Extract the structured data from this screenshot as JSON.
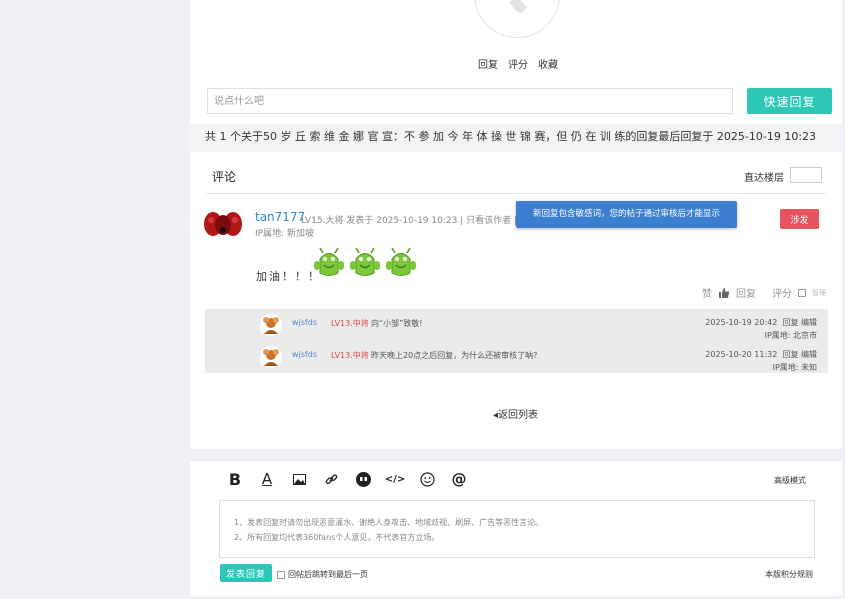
{
  "post_actions_top": [
    "回复",
    "评分",
    "收藏"
  ],
  "reply": {
    "placeholder": "说点什么吧",
    "quick_button": "快速回复"
  },
  "summary": "共 1 个关于50 岁 丘 索 维 金 娜 官 宣：不 参 加 今 年 体 操 世 锦 赛，但 仍 在 训 练的回复最后回复于 2025-10-19 10:23",
  "comments_section": {
    "title": "评论",
    "floor_jump_label": "直达楼层"
  },
  "post": {
    "username": "tan7177",
    "meta": "LV15.大将   发表于 2025-10-19 10:23   |  只看该作者   |",
    "ip": "IP属地: 新加坡",
    "text": "加油！！！",
    "notice": "新回复包含敏感词，您的帖子通过审核后才能显示",
    "report_button": "涉发",
    "actions": {
      "like": "赞",
      "reply": "回复",
      "rate": "评分",
      "manage": "管理"
    }
  },
  "subreplies": [
    {
      "name": "wjsfds",
      "rank": "LV13.中将",
      "text": "向“小邹”致敬!",
      "time": "2025-10-19 20:42",
      "reply": "回复",
      "edit": "编辑",
      "ip": "IP属地: 北京市"
    },
    {
      "name": "wjsfds",
      "rank": "LV13.中将",
      "text": "昨天晚上20点之后回复，为什么还被审核了呐?",
      "time": "2025-10-20 11:32",
      "reply": "回复",
      "edit": "编辑",
      "ip": "IP属地: 未知"
    }
  ],
  "back_link": "返回列表",
  "editor": {
    "advanced_mode": "高级模式",
    "notes": [
      "1、发表回复时请勿出现恶意灌水、谢绝人身攻击、地域歧视、刷屏、广告等恶性言论。",
      "2、所有回复均代表360fans个人意见，不代表官方立场。"
    ],
    "post_button": "发表回复",
    "jump_checkbox": "回帖后跳转到最后一页",
    "rules_link": "本版积分规则"
  },
  "colors": {
    "accent": "#2ec6b6",
    "link": "#2a88d8",
    "danger": "#e6545f",
    "notice": "#3c7fd1"
  }
}
